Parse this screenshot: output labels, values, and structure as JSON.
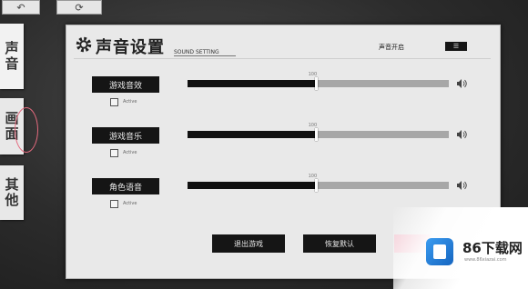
{
  "left_tabs": [
    {
      "label": "声音"
    },
    {
      "label": "画面"
    },
    {
      "label": "其他"
    }
  ],
  "panel": {
    "title": "声音设置",
    "subtitle": "SOUND SETTING",
    "sound_on_label": "声音开启",
    "sound_toggle": "☰"
  },
  "settings": [
    {
      "label": "游戏音效",
      "checkbox_text": "Active",
      "value_percent": 100
    },
    {
      "label": "游戏音乐",
      "checkbox_text": "Active",
      "value_percent": 100
    },
    {
      "label": "角色语音",
      "checkbox_text": "Active",
      "value_percent": 100
    }
  ],
  "footer": {
    "link_text": "",
    "exit_button": "退出游戏",
    "reset_button": "恢复默认"
  },
  "watermark": {
    "brand": "86下载网",
    "url": "www.86xiazai.com"
  },
  "icons": {
    "back": "back-arrow-icon",
    "refresh": "refresh-icon",
    "gear": "gear-icon",
    "volume": "speaker-icon"
  },
  "slider_fill_fraction": 0.49,
  "colors": {
    "panel_bg": "#e9e9e9",
    "dark": "#151515",
    "track": "#a7a7a7",
    "accent_link": "#7d9ac4"
  }
}
